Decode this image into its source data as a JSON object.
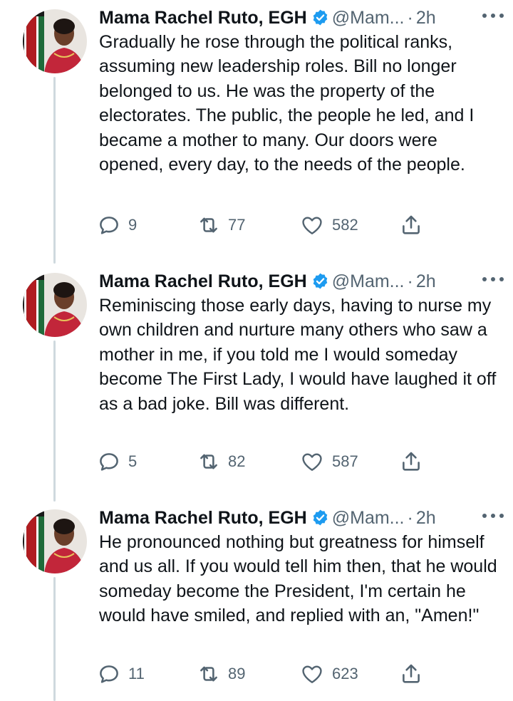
{
  "tweets": [
    {
      "name": "Mama Rachel Ruto, EGH",
      "handle": "@Mam...",
      "dot": "·",
      "time": "2h",
      "text": "Gradually he rose through the political ranks, assuming new leadership roles. Bill no longer belonged to us. He was the property of the electorates. The public, the people he led, and I became a mother to many. Our doors were opened, every day, to the needs of the people.",
      "replies": "9",
      "retweets": "77",
      "likes": "582"
    },
    {
      "name": "Mama Rachel Ruto, EGH",
      "handle": "@Mam...",
      "dot": "·",
      "time": "2h",
      "text": "Reminiscing those early days, having to nurse my own children and nurture many others who saw a mother in me, if you told me I would someday become The First Lady, I would have laughed it off as a bad joke. Bill was different.",
      "replies": "5",
      "retweets": "82",
      "likes": "587"
    },
    {
      "name": "Mama Rachel Ruto, EGH",
      "handle": "@Mam...",
      "dot": "·",
      "time": "2h",
      "text": "He pronounced nothing but greatness for himself and us all. If you would tell him then, that he would someday become the President, I'm certain he would have smiled, and replied with an, \"Amen!\"",
      "replies": "11",
      "retweets": "89",
      "likes": "623"
    }
  ],
  "icons": {
    "verified": "verified-badge-icon",
    "more": "more-horizontal-icon",
    "reply": "reply-bubble-icon",
    "retweet": "retweet-arrows-icon",
    "like": "heart-icon",
    "share": "share-upload-icon"
  },
  "colors": {
    "verified": "#1d9bf0",
    "secondary_text": "#536471",
    "thread_line": "#cfd9de"
  }
}
